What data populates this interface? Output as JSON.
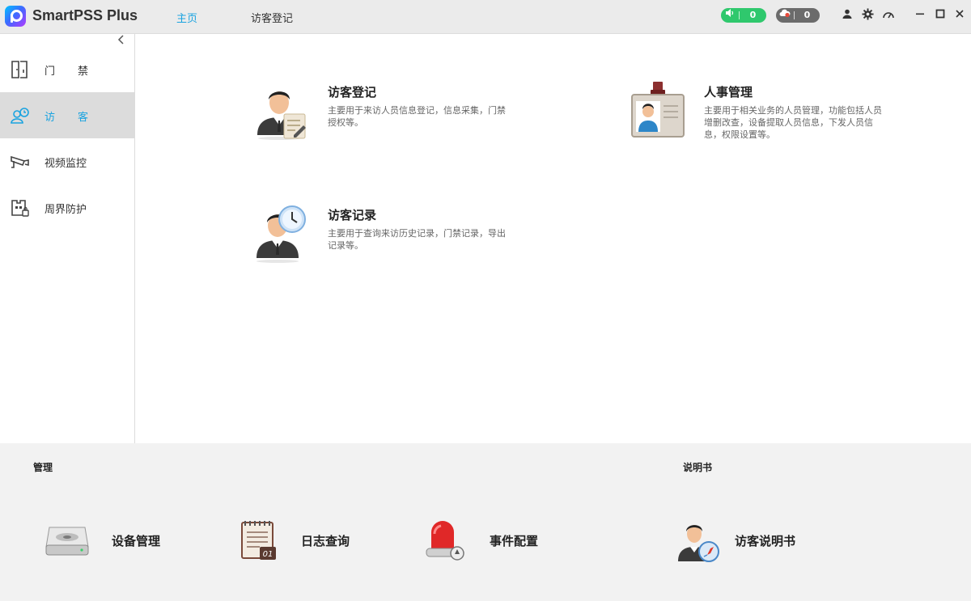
{
  "app": {
    "title": "SmartPSS Plus"
  },
  "nav": {
    "tabs": [
      {
        "label": "主页",
        "active": true
      },
      {
        "label": "访客登记",
        "active": false
      }
    ]
  },
  "status": {
    "sound_count": "0",
    "alarm_count": "0",
    "sound_color": "#2fc86d",
    "alarm_color": "#6b6b6b"
  },
  "toolbar": {
    "icons": [
      "user-icon",
      "settings-gear-icon",
      "performance-gauge-icon",
      "minimize-icon",
      "maximize-icon",
      "close-icon"
    ]
  },
  "sidebar": {
    "items": [
      {
        "label": "门禁",
        "icon": "door-icon",
        "active": false
      },
      {
        "label": "访客",
        "icon": "visitor-clock-icon",
        "active": true
      },
      {
        "label": "视频监控",
        "icon": "camera-icon",
        "active": false
      },
      {
        "label": "周界防护",
        "icon": "perimeter-icon",
        "active": false
      }
    ],
    "accent": "#1aa3e0"
  },
  "main": {
    "cards": [
      {
        "title": "访客登记",
        "desc": "主要用于来访人员信息登记，信息采集，门禁授权等。",
        "icon": "visitor-register-icon"
      },
      {
        "title": "人事管理",
        "desc": "主要用于相关业务的人员管理，功能包括人员增删改查，设备提取人员信息，下发人员信息，权限设置等。",
        "icon": "personnel-badge-icon"
      },
      {
        "title": "访客记录",
        "desc": "主要用于查询来访历史记录，门禁记录，导出记录等。",
        "icon": "visitor-record-icon"
      }
    ]
  },
  "bottom": {
    "manage_title": "管理",
    "manual_title": "说明书",
    "items": [
      {
        "label": "设备管理",
        "icon": "device-icon"
      },
      {
        "label": "日志查询",
        "icon": "log-calendar-icon"
      },
      {
        "label": "事件配置",
        "icon": "alarm-light-icon"
      },
      {
        "label": "访客说明书",
        "icon": "visitor-guide-icon"
      }
    ]
  }
}
